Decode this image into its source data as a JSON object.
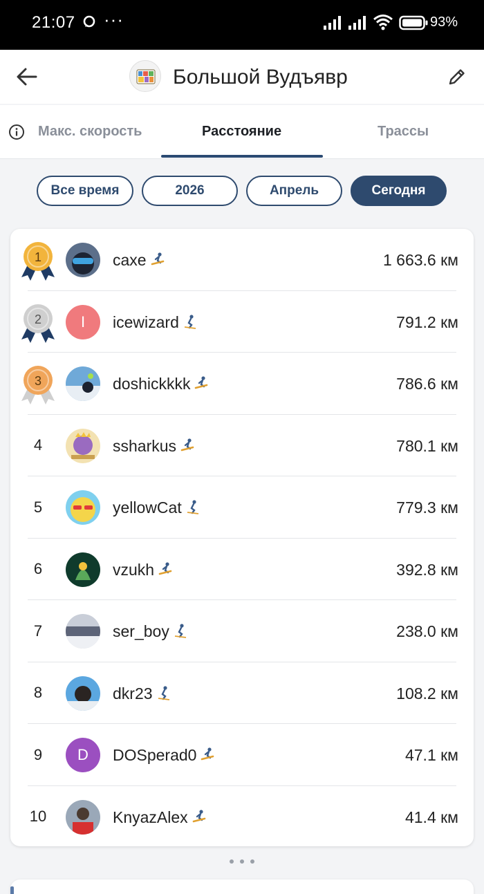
{
  "status_bar": {
    "time": "21:07",
    "dots": "···",
    "battery": "93%"
  },
  "app_bar": {
    "title": "Большой Вудъявр"
  },
  "tabs": [
    {
      "label": "Макс. скорость",
      "active": false
    },
    {
      "label": "Расстояние",
      "active": true
    },
    {
      "label": "Трассы",
      "active": false
    }
  ],
  "filters": [
    {
      "label": "Все время",
      "selected": false
    },
    {
      "label": "2026",
      "selected": false
    },
    {
      "label": "Апрель",
      "selected": false
    },
    {
      "label": "Сегодня",
      "selected": true
    }
  ],
  "leaderboard": [
    {
      "rank": "1",
      "name": "caxe",
      "distance": "1 663.6 км",
      "sport": "snowboard",
      "avatar": "photo"
    },
    {
      "rank": "2",
      "name": "icewizard",
      "distance": "791.2 км",
      "sport": "ski",
      "avatar_letter": "I",
      "avatar_color": "#f07a7d"
    },
    {
      "rank": "3",
      "name": "doshickkkk",
      "distance": "786.6 км",
      "sport": "snowboard",
      "avatar": "photo"
    },
    {
      "rank": "4",
      "name": "ssharkus",
      "distance": "780.1 км",
      "sport": "snowboard",
      "avatar": "photo"
    },
    {
      "rank": "5",
      "name": "yellowCat",
      "distance": "779.3 км",
      "sport": "ski",
      "avatar": "photo"
    },
    {
      "rank": "6",
      "name": "vzukh",
      "distance": "392.8 км",
      "sport": "snowboard",
      "avatar": "photo"
    },
    {
      "rank": "7",
      "name": "ser_boy",
      "distance": "238.0 км",
      "sport": "ski",
      "avatar": "photo"
    },
    {
      "rank": "8",
      "name": "dkr23",
      "distance": "108.2 км",
      "sport": "ski",
      "avatar": "photo"
    },
    {
      "rank": "9",
      "name": "DOSperad0",
      "distance": "47.1 км",
      "sport": "snowboard",
      "avatar_letter": "D",
      "avatar_color": "#9b4fc0"
    },
    {
      "rank": "10",
      "name": "KnyazAlex",
      "distance": "41.4 км",
      "sport": "snowboard",
      "avatar": "photo"
    }
  ],
  "colors": {
    "accent": "#2e4a6e",
    "gold": "#f2b43c",
    "silver": "#cfcfcf",
    "bronze": "#f0a55a",
    "ribbon": "#1f3b64"
  }
}
